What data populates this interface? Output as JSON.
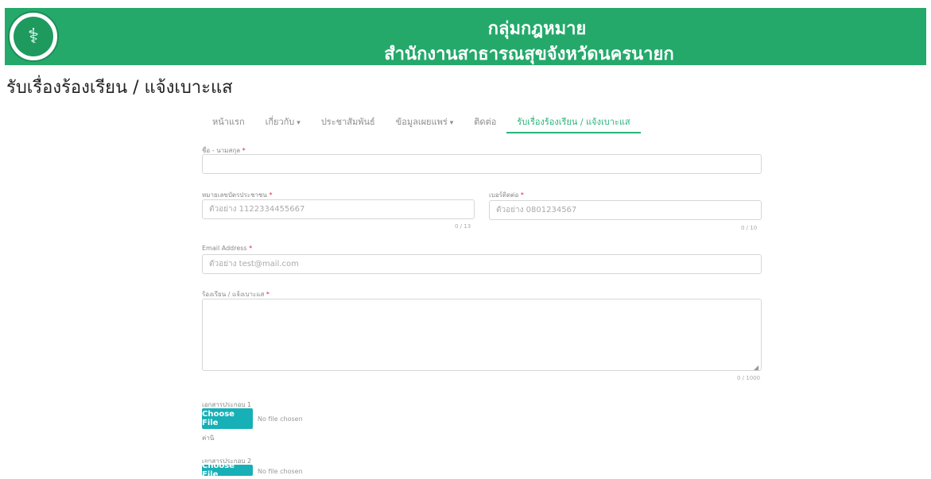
{
  "header": {
    "line1": "กลุ่มกฎหมาย",
    "line2": "สำนักงานสาธารณสุขจังหวัดนครนายก"
  },
  "page_title": "รับเรื่องร้องเรียน / แจ้งเบาะแส",
  "nav": {
    "items": [
      {
        "label": "หน้าแรก",
        "dropdown": false,
        "active": false
      },
      {
        "label": "เกี่ยวกับ",
        "dropdown": true,
        "active": false
      },
      {
        "label": "ประชาสัมพันธ์",
        "dropdown": false,
        "active": false
      },
      {
        "label": "ข้อมูลเผยแพร่",
        "dropdown": true,
        "active": false
      },
      {
        "label": "ติดต่อ",
        "dropdown": false,
        "active": false
      },
      {
        "label": "รับเรื่องร้องเรียน / แจ้งเบาะแส",
        "dropdown": false,
        "active": true
      }
    ],
    "caret": "▾"
  },
  "form": {
    "name_label": "ชื่อ - นามสกุล",
    "id_label": "หมายเลขบัตรประชาชน",
    "id_placeholder": "ตัวอย่าง 1122334455667",
    "id_counter": "0 / 13",
    "phone_label": "เบอร์ติดต่อ",
    "phone_placeholder": "ตัวอย่าง 0801234567",
    "phone_counter": "0 / 10",
    "email_label": "Email Address",
    "email_placeholder": "ตัวอย่าง test@mail.com",
    "complaint_label": "ร้องเรียน / แจ้งเบาะแส",
    "complaint_counter": "0 / 1000",
    "required_mark": "*",
    "file1_label": "เอกสารประกอบ 1",
    "file2_label": "เอกสารประกอบ 2",
    "file_button": "Choose File",
    "file_none": "No file chosen",
    "file_note": "ค่านิ"
  }
}
